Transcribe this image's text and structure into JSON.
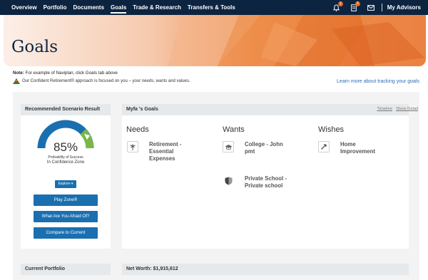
{
  "nav": {
    "items": [
      "Overview",
      "Portfolio",
      "Documents",
      "Goals",
      "Trade & Research",
      "Transfers & Tools"
    ],
    "active": "Goals",
    "notifications_count": "1",
    "documents_count": "2",
    "my_advisors": "My Advisors"
  },
  "hero": {
    "title": "Goals"
  },
  "note": {
    "label": "Note:",
    "text": "For example of Naviplan, click Goals tab above"
  },
  "confident_text": "Our Confident Retirement® approach is focused on you – your needs, wants and values.",
  "learn_link": "Learn more about tracking your goals",
  "scenario": {
    "header": "Recommended Scenario Result",
    "percent": "85%",
    "percent_value": 0.85,
    "prob_label": "Probability of Success",
    "zone_label": "In Confidence Zone",
    "explore": "Explore ▾",
    "buttons": [
      "Play Zone®",
      "What Are You Afraid Of?",
      "Compare to Current"
    ]
  },
  "goals": {
    "header": "Myfa 's Goals",
    "links": [
      "Timeline",
      "Show Detail"
    ],
    "needs": {
      "title": "Needs",
      "items": [
        "Retirement - Essential Expenses"
      ]
    },
    "wants": {
      "title": "Wants",
      "items": [
        "College - John pmt",
        "Private School - Private school"
      ]
    },
    "wishes": {
      "title": "Wishes",
      "items": [
        "Home Improvement"
      ]
    }
  },
  "current_portfolio": {
    "header": "Current Portfolio"
  },
  "net_worth": {
    "label": "Net Worth:",
    "value": "$1,915,612"
  },
  "colors": {
    "nav": "#0c2440",
    "accent": "#e0672a",
    "button": "#1a6fb0",
    "gauge": "#1a6fb0",
    "gauge_green": "#7ab648"
  }
}
